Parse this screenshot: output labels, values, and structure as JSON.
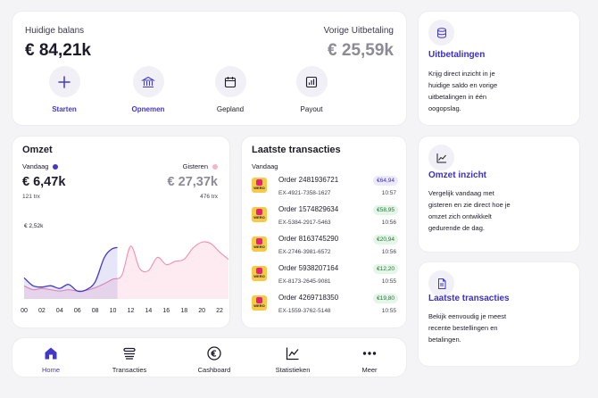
{
  "balance": {
    "current_label": "Huidige balans",
    "current_value": "€ 84,21k",
    "previous_label": "Vorige Uitbetaling",
    "previous_value": "€ 25,59k",
    "actions": [
      {
        "label": "Starten",
        "icon": "plus-icon",
        "active": true
      },
      {
        "label": "Opnemen",
        "icon": "bank-icon",
        "active": true
      },
      {
        "label": "Gepland",
        "icon": "calendar-icon",
        "active": false
      },
      {
        "label": "Payout",
        "icon": "bar-chart-icon",
        "active": false
      }
    ]
  },
  "omzet": {
    "title": "Omzet",
    "today_label": "Vandaag",
    "today_value": "€ 6,47k",
    "today_count": "121 trx",
    "yesterday_label": "Gisteren",
    "yesterday_value": "€ 27,37k",
    "yesterday_count": "476 trx",
    "tooltip": "€ 2,52k"
  },
  "chart_data": {
    "type": "area",
    "x_ticks": [
      "00",
      "02",
      "04",
      "06",
      "08",
      "10",
      "12",
      "14",
      "16",
      "18",
      "20",
      "22"
    ],
    "series": [
      {
        "name": "Vandaag",
        "color": "#4338ca",
        "x": [
          0,
          1,
          2,
          3,
          4,
          5,
          6,
          7,
          8,
          9,
          9.8,
          10.5
        ],
        "values": [
          0.32,
          0.2,
          0.18,
          0.2,
          0.16,
          0.22,
          0.12,
          0.14,
          0.26,
          0.62,
          0.75,
          0.78
        ]
      },
      {
        "name": "Gisteren",
        "color": "#f28fb0",
        "x": [
          0,
          1,
          2,
          3,
          4,
          5,
          6,
          7,
          8,
          9,
          10,
          11,
          12,
          13,
          14,
          15,
          16,
          17,
          18,
          19,
          20,
          21,
          22,
          23
        ],
        "values": [
          0.2,
          0.14,
          0.16,
          0.14,
          0.12,
          0.14,
          0.12,
          0.13,
          0.17,
          0.23,
          0.3,
          0.36,
          0.8,
          0.46,
          0.43,
          0.63,
          0.52,
          0.57,
          0.6,
          0.77,
          0.86,
          0.84,
          0.71,
          0.6
        ]
      }
    ],
    "xlim": [
      0,
      23
    ],
    "ylim": [
      0,
      1
    ]
  },
  "transactions": {
    "title": "Laatste transacties",
    "group_label": "Vandaag",
    "items": [
      {
        "title": "Order 2481936721",
        "ref": "EX-4921-7358-1627",
        "amount": "€64,94",
        "time": "10:57",
        "variant": "purple"
      },
      {
        "title": "Order 1574829634",
        "ref": "EX-5384-2917-5463",
        "amount": "€58,95",
        "time": "10:56",
        "variant": "green"
      },
      {
        "title": "Order 8163745290",
        "ref": "EX-2746-3981-6572",
        "amount": "€20,94",
        "time": "10:56",
        "variant": "green"
      },
      {
        "title": "Order 5938207164",
        "ref": "EX-8173-2645-9081",
        "amount": "€12,20",
        "time": "10:55",
        "variant": "green"
      },
      {
        "title": "Order 4269718350",
        "ref": "EX-1559-3762-5148",
        "amount": "€19,80",
        "time": "10:55",
        "variant": "green"
      }
    ],
    "logo_text": "WERO"
  },
  "features": [
    {
      "title": "Uitbetalingen",
      "text": "Krijg direct inzicht in je huidige saldo en vorige uitbetalingen in één oogopslag.",
      "icon": "coins-icon"
    },
    {
      "title": "Omzet inzicht",
      "text": "Vergelijk vandaag met gisteren en zie direct hoe je omzet zich ontwikkelt gedurende de dag.",
      "icon": "line-chart-icon"
    },
    {
      "title": "Laatste transacties",
      "text": "Bekijk eenvoudig je meest recente bestellingen en betalingen.",
      "icon": "document-icon"
    }
  ],
  "nav": [
    {
      "label": "Home",
      "icon": "home-icon",
      "active": true
    },
    {
      "label": "Transacties",
      "icon": "stack-icon",
      "active": false
    },
    {
      "label": "Cashboard",
      "icon": "euro-icon",
      "active": false
    },
    {
      "label": "Statistieken",
      "icon": "line-chart-icon",
      "active": false
    },
    {
      "label": "Meer",
      "icon": "more-icon",
      "active": false
    }
  ],
  "colors": {
    "accent": "#4338ca",
    "today_line": "#4338ca",
    "yesterday_line": "#f28fb0",
    "amount_purple_bg": "#ece9fb",
    "amount_green_bg": "#e4f6e7"
  }
}
